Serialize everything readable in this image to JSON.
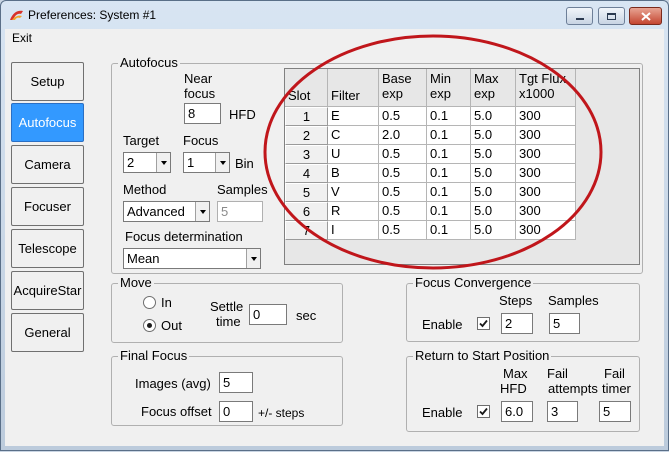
{
  "window": {
    "title": "Preferences: System #1",
    "min_icon": "minimize-icon",
    "max_icon": "maximize-icon",
    "close_icon": "close-icon"
  },
  "menu": {
    "exit": "Exit"
  },
  "nav": {
    "items": [
      "Setup",
      "Autofocus",
      "Camera",
      "Focuser",
      "Telescope",
      "AcquireStar",
      "General"
    ],
    "active": "Autofocus"
  },
  "autofocus": {
    "title": "Autofocus",
    "near_focus_label_1": "Near",
    "near_focus_label_2": "focus",
    "near_focus_value": "8",
    "hfd_label": "HFD",
    "target_label": "Target",
    "target_value": "2",
    "focus_label": "Focus",
    "focus_value": "1",
    "bin_label": "Bin",
    "method_label": "Method",
    "method_value": "Advanced",
    "samples_label": "Samples",
    "samples_value": "5",
    "focus_determination_label": "Focus determination",
    "focus_determination_value": "Mean",
    "table": {
      "headers": {
        "slot": "Slot",
        "filter": "Filter",
        "base_exp_1": "Base",
        "base_exp_2": "exp",
        "min_exp_1": "Min",
        "min_exp_2": "exp",
        "max_exp_1": "Max",
        "max_exp_2": "exp",
        "tgt_flux_1": "Tgt Flux",
        "tgt_flux_2": "x1000"
      },
      "rows": [
        {
          "slot": "1",
          "filter": "E",
          "base": "0.5",
          "min": "0.1",
          "max": "5.0",
          "tgt": "300"
        },
        {
          "slot": "2",
          "filter": "C",
          "base": "2.0",
          "min": "0.1",
          "max": "5.0",
          "tgt": "300"
        },
        {
          "slot": "3",
          "filter": "U",
          "base": "0.5",
          "min": "0.1",
          "max": "5.0",
          "tgt": "300"
        },
        {
          "slot": "4",
          "filter": "B",
          "base": "0.5",
          "min": "0.1",
          "max": "5.0",
          "tgt": "300"
        },
        {
          "slot": "5",
          "filter": "V",
          "base": "0.5",
          "min": "0.1",
          "max": "5.0",
          "tgt": "300"
        },
        {
          "slot": "6",
          "filter": "R",
          "base": "0.5",
          "min": "0.1",
          "max": "5.0",
          "tgt": "300"
        },
        {
          "slot": "7",
          "filter": "I",
          "base": "0.5",
          "min": "0.1",
          "max": "5.0",
          "tgt": "300"
        }
      ]
    }
  },
  "move": {
    "title": "Move",
    "in_label": "In",
    "out_label": "Out",
    "selected": "Out",
    "settle_label_1": "Settle",
    "settle_label_2": "time",
    "settle_value": "0",
    "sec_label": "sec"
  },
  "final_focus": {
    "title": "Final Focus",
    "images_label": "Images (avg)",
    "images_value": "5",
    "offset_label": "Focus offset",
    "offset_value": "0",
    "steps_label": "+/- steps"
  },
  "focus_convergence": {
    "title": "Focus Convergence",
    "steps_label": "Steps",
    "samples_label": "Samples",
    "enable_label": "Enable",
    "enabled": true,
    "steps_value": "2",
    "samples_value": "5"
  },
  "return_to_start": {
    "title": "Return to Start Position",
    "max_hfd_label_1": "Max",
    "max_hfd_label_2": "HFD",
    "fail_attempts_label_1": "Fail",
    "fail_attempts_label_2": "attempts",
    "fail_timer_label_1": "Fail",
    "fail_timer_label_2": "timer",
    "enable_label": "Enable",
    "enabled": true,
    "max_hfd_value": "6.0",
    "fail_attempts_value": "3",
    "fail_timer_value": "5"
  },
  "colors": {
    "active_nav": "#3399ff",
    "annotation_ellipse": "#c0161b"
  }
}
